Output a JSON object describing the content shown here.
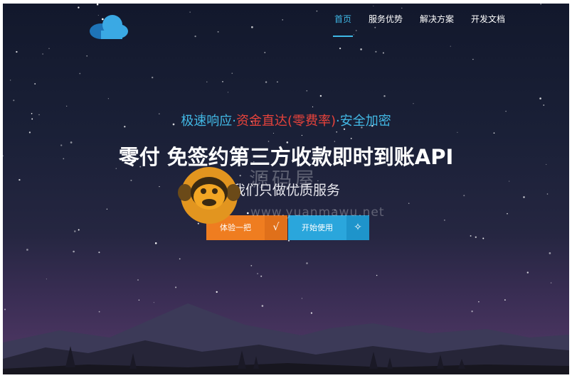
{
  "nav": {
    "items": [
      {
        "label": "首页",
        "active": true
      },
      {
        "label": "服务优势",
        "active": false
      },
      {
        "label": "解决方案",
        "active": false
      },
      {
        "label": "开发文档",
        "active": false
      }
    ]
  },
  "hero": {
    "tagline": {
      "part1": "极速响应·",
      "part2": "资金直达(零费率)",
      "part3": "·安全加密"
    },
    "headline": "零付 免签约第三方收款即时到账API",
    "subline": "我们只做优质服务"
  },
  "buttons": {
    "try_label": "体验一把",
    "try_icon": "√",
    "start_label": "开始使用",
    "start_icon": "✧"
  },
  "watermark": {
    "text": "源码屋",
    "url": "www.yuanmawu.net"
  },
  "colors": {
    "accent_blue": "#3fb8e6",
    "accent_red": "#e8433b",
    "button_orange": "#ef7d20",
    "button_blue": "#2aa6dc"
  }
}
